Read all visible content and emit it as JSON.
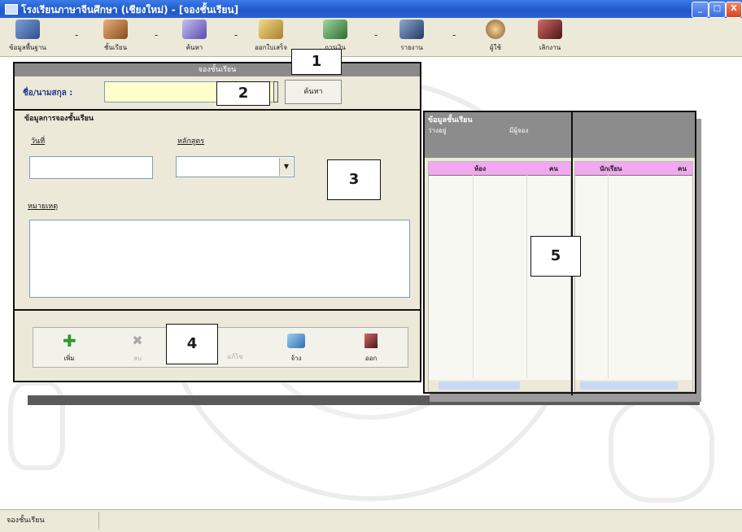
{
  "window": {
    "title": "โรงเรียนภาษาจีนศึกษา (เชียงใหม่) - [จองชั้นเรียน]",
    "min_label": "_",
    "max_label": "□",
    "close_label": "X"
  },
  "toolbar": {
    "items": [
      {
        "label": "ข้อมูลพื้นฐาน",
        "icon": "book-icon",
        "color": "#3a5a8c"
      },
      {
        "label": "ชั้นเรียน",
        "icon": "classroom-icon",
        "color": "#b5651d"
      },
      {
        "label": "ค้นหา",
        "icon": "search-icon",
        "color": "#6a5acd"
      },
      {
        "label": "ออกใบเสร็จ",
        "icon": "receipt-icon",
        "color": "#c8a13a"
      },
      {
        "label": "การเงิน",
        "icon": "money-icon",
        "color": "#3d7a3d"
      },
      {
        "label": "รายงาน",
        "icon": "report-icon",
        "color": "#334f7a"
      },
      {
        "label": "ผู้ใช้",
        "icon": "user-icon",
        "color": "#8b5a2b"
      },
      {
        "label": "เลิกงาน",
        "icon": "exit-icon",
        "color": "#7a2a2a"
      }
    ],
    "separator": "-"
  },
  "dialog": {
    "title": "จองชั้นเรียน",
    "name_label": "ชื่อ/นามสกุล :",
    "name_value": "",
    "search_button": "ค้นหา",
    "booking_group": "ข้อมูลการจองชั้นเรียน",
    "date_label": "วันที่",
    "course_label": "หลักสูตร",
    "date_value": "",
    "course_value": "",
    "note_label": "หมายเหตุ",
    "note_value": ""
  },
  "actions": {
    "add": "เพิ่ม",
    "delete": "ลบ",
    "edit": "แก้ไข",
    "save": "จ้าง",
    "exit": "ออก"
  },
  "class_panel": {
    "title": "ข้อมูลชั้นเรียน",
    "sub_left": "ว่างอยู่",
    "sub_right": "มีผู้จอง",
    "left_columns": [
      "ห้อง",
      "คน"
    ],
    "right_columns": [
      "นักเรียน",
      "คน"
    ]
  },
  "callouts": [
    "1",
    "2",
    "3",
    "4",
    "5"
  ],
  "statusbar": {
    "text": "จองชั้นเรียน"
  },
  "colors": {
    "titlebar": "#2a63d6",
    "face": "#ece9d8",
    "name_field": "#ffffcc",
    "grid_header": "#f2a8f0",
    "scroll": "#c9d8f5"
  }
}
